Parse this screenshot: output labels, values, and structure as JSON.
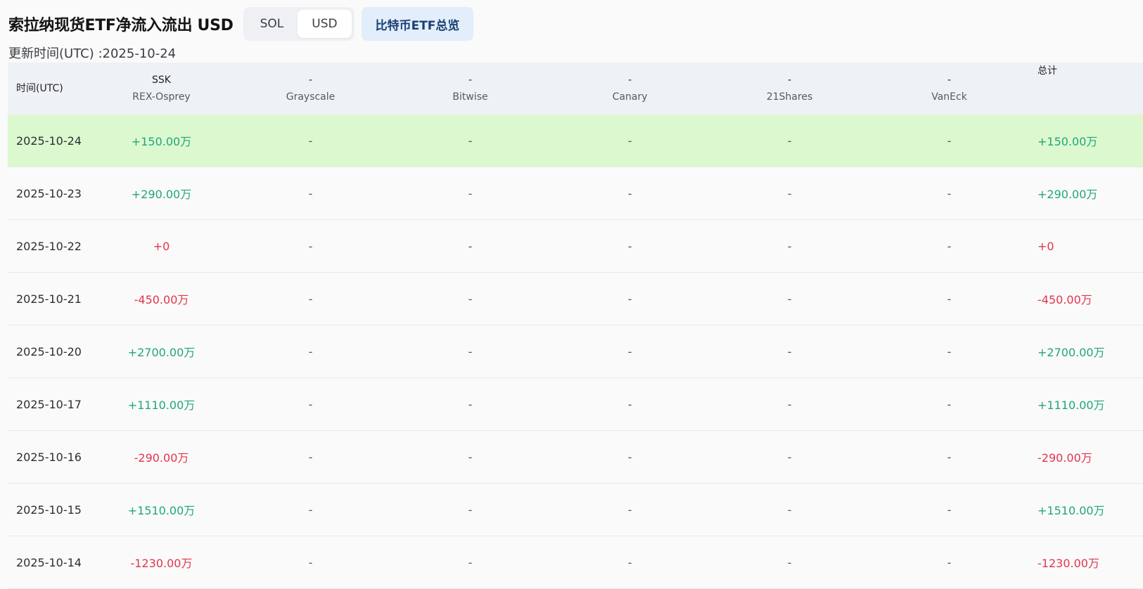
{
  "header": {
    "title": "索拉纳现货ETF净流入流出 USD",
    "unit_options": [
      "SOL",
      "USD"
    ],
    "selected_unit": "USD",
    "btc_overview_label": "比特币ETF总览",
    "updated_text": "更新时间(UTC) :2025-10-24"
  },
  "colors": {
    "positive": "#20a67a",
    "negative": "#e2354d",
    "highlight_row": "#dcf8cf",
    "header_bg": "#eef1f5"
  },
  "table": {
    "columns": [
      {
        "code": "时间(UTC)",
        "issuer": ""
      },
      {
        "code": "SSK",
        "issuer": "REX-Osprey"
      },
      {
        "code": "-",
        "issuer": "Grayscale"
      },
      {
        "code": "-",
        "issuer": "Bitwise"
      },
      {
        "code": "-",
        "issuer": "Canary"
      },
      {
        "code": "-",
        "issuer": "21Shares"
      },
      {
        "code": "-",
        "issuer": "VanEck"
      },
      {
        "code": "总计",
        "issuer": ""
      }
    ],
    "rows": [
      {
        "date": "2025-10-24",
        "ssk": "+150.00万",
        "grayscale": "-",
        "bitwise": "-",
        "canary": "-",
        "shares21": "-",
        "vaneck": "-",
        "total": "+150.00万",
        "sign": "pos",
        "highlight": true
      },
      {
        "date": "2025-10-23",
        "ssk": "+290.00万",
        "grayscale": "-",
        "bitwise": "-",
        "canary": "-",
        "shares21": "-",
        "vaneck": "-",
        "total": "+290.00万",
        "sign": "pos",
        "highlight": false
      },
      {
        "date": "2025-10-22",
        "ssk": "+0",
        "grayscale": "-",
        "bitwise": "-",
        "canary": "-",
        "shares21": "-",
        "vaneck": "-",
        "total": "+0",
        "sign": "neg",
        "highlight": false
      },
      {
        "date": "2025-10-21",
        "ssk": "-450.00万",
        "grayscale": "-",
        "bitwise": "-",
        "canary": "-",
        "shares21": "-",
        "vaneck": "-",
        "total": "-450.00万",
        "sign": "neg",
        "highlight": false
      },
      {
        "date": "2025-10-20",
        "ssk": "+2700.00万",
        "grayscale": "-",
        "bitwise": "-",
        "canary": "-",
        "shares21": "-",
        "vaneck": "-",
        "total": "+2700.00万",
        "sign": "pos",
        "highlight": false
      },
      {
        "date": "2025-10-17",
        "ssk": "+1110.00万",
        "grayscale": "-",
        "bitwise": "-",
        "canary": "-",
        "shares21": "-",
        "vaneck": "-",
        "total": "+1110.00万",
        "sign": "pos",
        "highlight": false
      },
      {
        "date": "2025-10-16",
        "ssk": "-290.00万",
        "grayscale": "-",
        "bitwise": "-",
        "canary": "-",
        "shares21": "-",
        "vaneck": "-",
        "total": "-290.00万",
        "sign": "neg",
        "highlight": false
      },
      {
        "date": "2025-10-15",
        "ssk": "+1510.00万",
        "grayscale": "-",
        "bitwise": "-",
        "canary": "-",
        "shares21": "-",
        "vaneck": "-",
        "total": "+1510.00万",
        "sign": "pos",
        "highlight": false
      },
      {
        "date": "2025-10-14",
        "ssk": "-1230.00万",
        "grayscale": "-",
        "bitwise": "-",
        "canary": "-",
        "shares21": "-",
        "vaneck": "-",
        "total": "-1230.00万",
        "sign": "neg",
        "highlight": false
      }
    ]
  }
}
